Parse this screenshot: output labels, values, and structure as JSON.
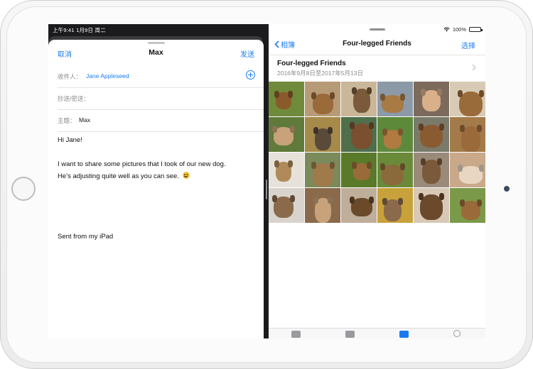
{
  "status_bar": {
    "time": "上午9:41",
    "date": "1月9日 周二",
    "battery": "100%"
  },
  "mail": {
    "cancel_label": "取消",
    "title": "Max",
    "send_label": "发送",
    "to_label": "收件人：",
    "to_value": "Jane Appleseed",
    "cc_label": "抄送/密送：",
    "subject_label": "主题：",
    "subject_value": "Max",
    "body": {
      "greeting": "Hi Jane!",
      "line1": "I want to share some pictures that I took of our new dog.",
      "line2": "He’s adjusting quite well as you can see.",
      "signature": "Sent from my iPad"
    }
  },
  "photos": {
    "back_label": "相簿",
    "title": "Four-legged Friends",
    "select_label": "选择",
    "album_name": "Four-legged Friends",
    "album_dates": "2016年9月8日至2017年5月13日",
    "tiles": [
      {
        "bg": "#6f8a3a",
        "dog": "#8a5a2b"
      },
      {
        "bg": "#b79b76",
        "dog": "#9b6a3a"
      },
      {
        "bg": "#c9b79a",
        "dog": "#7a5a3a"
      },
      {
        "bg": "#8c9aa8",
        "dog": "#a87a44"
      },
      {
        "bg": "#7c6a5c",
        "dog": "#d9b08a"
      },
      {
        "bg": "#d8cbb6",
        "dog": "#9a6b3a"
      },
      {
        "bg": "#5f7a3a",
        "dog": "#c7a27a"
      },
      {
        "bg": "#a58a4a",
        "dog": "#5a4a3a"
      },
      {
        "bg": "#4e6f4a",
        "dog": "#7a5030"
      },
      {
        "bg": "#5d8a3a",
        "dog": "#b07a40"
      },
      {
        "bg": "#7a7a6a",
        "dog": "#8a5a30"
      },
      {
        "bg": "#a37a4a",
        "dog": "#9a6a3a"
      },
      {
        "bg": "#e6e2da",
        "dog": "#b08a5a"
      },
      {
        "bg": "#7a8a5a",
        "dog": "#a07a4a"
      },
      {
        "bg": "#5a7a2a",
        "dog": "#9a6b3a"
      },
      {
        "bg": "#6a8a3a",
        "dog": "#8a6a3a"
      },
      {
        "bg": "#9a8a7a",
        "dog": "#7a5a3a"
      },
      {
        "bg": "#c9a98a",
        "dog": "#e8d6c2"
      },
      {
        "bg": "#d8d3cc",
        "dog": "#8a6a4a"
      },
      {
        "bg": "#8a6a4a",
        "dog": "#c7a27a"
      },
      {
        "bg": "#bfae9a",
        "dog": "#6a4a2a"
      },
      {
        "bg": "#c7a23a",
        "dog": "#8a6a4a"
      },
      {
        "bg": "#d8c8b6",
        "dog": "#6a4a2a"
      },
      {
        "bg": "#7a9a4a",
        "dog": "#9a6a3a"
      }
    ]
  },
  "colors": {
    "accent": "#1a7bf0"
  }
}
